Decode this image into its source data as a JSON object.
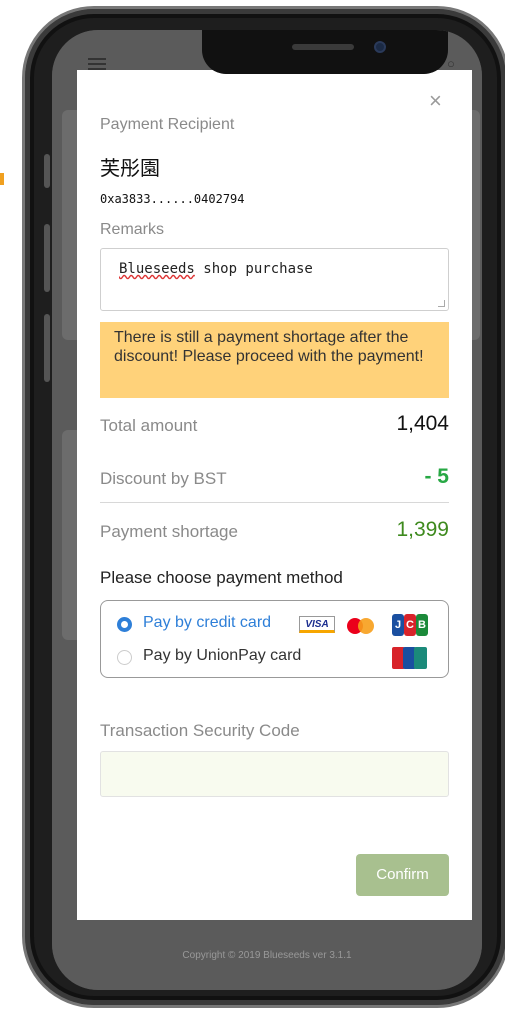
{
  "modal": {
    "close_icon": "×",
    "recipient_label": "Payment Recipient",
    "recipient_name": "芙彤園",
    "recipient_address": "0xa3833......0402794",
    "remarks_label": "Remarks",
    "remarks_value_word1": "Blueseeds",
    "remarks_value_rest": " shop purchase",
    "warning_text": "There is still a payment shortage after the discount! Please proceed with the payment!",
    "warning_color": "#ffd27a",
    "total_label": "Total amount",
    "total_value": "1,404",
    "discount_label": "Discount by BST",
    "discount_value": "- 5",
    "discount_color": "#27a844",
    "shortage_label": "Payment shortage",
    "shortage_value": "1,399",
    "shortage_color": "#3e8a1e",
    "method_title": "Please choose payment method",
    "options": [
      {
        "label": "Pay by credit card",
        "selected": true,
        "color": "#2e7fd8"
      },
      {
        "label": "Pay by UnionPay card",
        "selected": false,
        "color": "#333333"
      }
    ],
    "card_logos": {
      "visa": "VISA",
      "mastercard": "mastercard-icon",
      "jcb": [
        "J",
        "C",
        "B"
      ],
      "unionpay": "unionpay-icon"
    },
    "security_label": "Transaction Security Code",
    "security_value": "",
    "confirm_label": "Confirm",
    "confirm_color": "#a8c08f"
  },
  "footer": {
    "copyright": "Copyright © 2019 Blueseeds ver 3.1.1"
  }
}
